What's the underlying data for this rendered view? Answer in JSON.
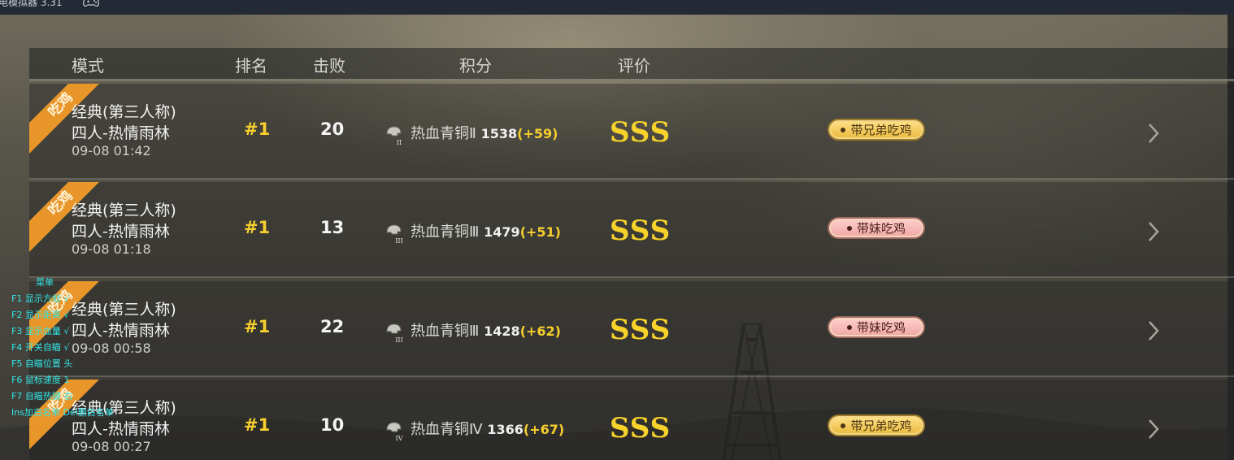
{
  "window": {
    "title": "电模拟器 3.31",
    "gamepad_icon": "gamepad-icon"
  },
  "header": {
    "mode": "模式",
    "rank": "排名",
    "kills": "击败",
    "score": "积分",
    "rating": "评价"
  },
  "matches": [
    {
      "badge": "吃鸡",
      "mode_line1": "经典(第三人称)",
      "mode_line2": "四人-热情雨林",
      "datetime": "09-08 01:42",
      "rank": "#1",
      "kills": "20",
      "tier_name": "热血青铜Ⅱ",
      "tier_icon_level": "II",
      "score": "1538",
      "score_delta": "(+59)",
      "grade": "SSS",
      "action": "带兄弟吃鸡",
      "action_style": "gold"
    },
    {
      "badge": "吃鸡",
      "mode_line1": "经典(第三人称)",
      "mode_line2": "四人-热情雨林",
      "datetime": "09-08 01:18",
      "rank": "#1",
      "kills": "13",
      "tier_name": "热血青铜Ⅲ",
      "tier_icon_level": "III",
      "score": "1479",
      "score_delta": "(+51)",
      "grade": "SSS",
      "action": "带妹吃鸡",
      "action_style": "pink"
    },
    {
      "badge": "吃鸡",
      "mode_line1": "经典(第三人称)",
      "mode_line2": "四人-热情雨林",
      "datetime": "09-08 00:58",
      "rank": "#1",
      "kills": "22",
      "tier_name": "热血青铜Ⅲ",
      "tier_icon_level": "III",
      "score": "1428",
      "score_delta": "(+62)",
      "grade": "SSS",
      "action": "带妹吃鸡",
      "action_style": "pink"
    },
    {
      "badge": "吃鸡",
      "mode_line1": "经典(第三人称)",
      "mode_line2": "四人-热情雨林",
      "datetime": "09-08 00:27",
      "rank": "#1",
      "kills": "10",
      "tier_name": "热血青铜Ⅳ",
      "tier_icon_level": "IV",
      "score": "1366",
      "score_delta": "(+67)",
      "grade": "SSS",
      "action": "带兄弟吃鸡",
      "action_style": "gold"
    }
  ],
  "overlay_menu": [
    "菜单",
    "F1 显示方框  √",
    "F2 显示距离  √",
    "F3 显示血量  √",
    "F4 开关自瞄  √",
    "F5 自瞄位置  头",
    "F6 鼠标速度  1",
    "F7 自瞄热键  右",
    "Ins加白名单 Del删白名单"
  ],
  "colors": {
    "rank": "#f6cf2e",
    "grade": "#f6d22a",
    "ribbon": "#e8962a",
    "overlay_text": "#33e6e6",
    "pill_gold": "#ffe28a",
    "pill_pink": "#ffd0cc"
  }
}
